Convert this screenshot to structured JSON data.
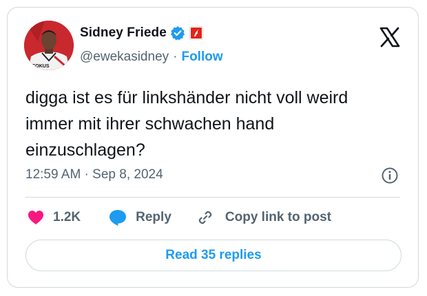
{
  "author": {
    "display_name": "Sidney Friede",
    "handle": "@ewekasidney",
    "separator": "·",
    "follow_label": "Follow",
    "avatar_shirt_text": "FOKUS"
  },
  "tweet": {
    "text": "digga ist es für linkshänder nicht voll weird immer mit ihrer schwachen hand einzuschlagen?",
    "timestamp": "12:59 AM · Sep 8, 2024"
  },
  "actions": {
    "like_count": "1.2K",
    "reply_label": "Reply",
    "copy_label": "Copy link to post"
  },
  "read_replies_label": "Read 35 replies",
  "colors": {
    "accent": "#1d9bf0",
    "like": "#f91880",
    "secondary_text": "#536471",
    "border": "#cfd9de"
  },
  "icons": [
    "verified-badge-icon",
    "affiliation-badge-icon",
    "x-logo-icon",
    "info-icon",
    "heart-icon",
    "reply-icon",
    "link-icon"
  ]
}
